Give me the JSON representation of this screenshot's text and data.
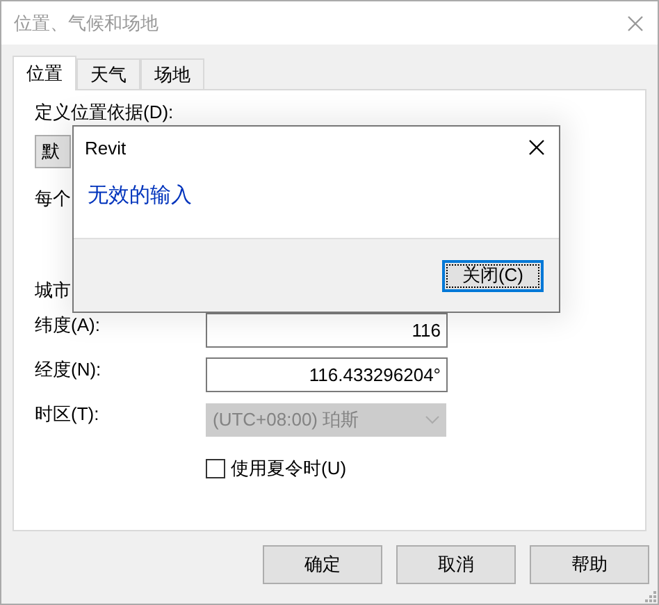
{
  "window": {
    "title": "位置、气候和场地"
  },
  "tabs": [
    {
      "label": "位置",
      "selected": true
    },
    {
      "label": "天气",
      "selected": false
    },
    {
      "label": "场地",
      "selected": false
    }
  ],
  "location": {
    "define_label": "定义位置依据(D):",
    "define_value": "默",
    "per_label": "每个",
    "city_label": "城市",
    "latitude_label": "纬度(A):",
    "latitude_value": "116",
    "longitude_label": "经度(N):",
    "longitude_value": "116.433296204°",
    "timezone_label": "时区(T):",
    "timezone_value": "(UTC+08:00) 珀斯",
    "timezone_disabled": true,
    "dst": {
      "label": "使用夏令时(U)",
      "checked": false
    }
  },
  "buttons": [
    "确定",
    "取消",
    "帮助"
  ],
  "message_box": {
    "title": "Revit",
    "message": "无效的输入",
    "button": "关闭(C)"
  }
}
